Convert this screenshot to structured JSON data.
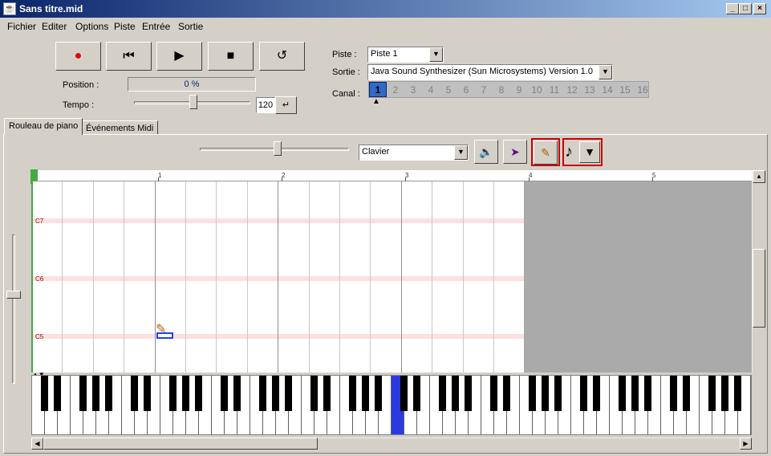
{
  "window": {
    "title": "Sans titre.mid",
    "app_icon": "java-cup-icon",
    "controls": {
      "minimize": "_",
      "maximize": "□",
      "close": "×"
    }
  },
  "menu": [
    "Fichier",
    "Editer",
    "Options",
    "Piste",
    "Entrée",
    "Sortie"
  ],
  "transport": {
    "record": "●",
    "rewind": "⏮",
    "play": "▶",
    "stop": "■",
    "loop": "↺"
  },
  "position": {
    "label": "Position :",
    "value": "0 %"
  },
  "tempo": {
    "label": "Tempo :",
    "value": "120",
    "apply": "↵",
    "slider_level": 0.55
  },
  "piste": {
    "label": "Piste :",
    "value": "Piste 1"
  },
  "sortie": {
    "label": "Sortie :",
    "value": "Java Sound Synthesizer (Sun Microsystems) Version 1.0"
  },
  "canal": {
    "label": "Canal :",
    "selected": "1",
    "channels": [
      "1",
      "2",
      "3",
      "4",
      "5",
      "6",
      "7",
      "8",
      "9",
      "10",
      "11",
      "12",
      "13",
      "14",
      "15",
      "16"
    ]
  },
  "tabs": [
    "Rouleau de piano",
    "Événements Midi"
  ],
  "editor": {
    "zoom_level": 0.55,
    "mode": "Clavier",
    "tools": {
      "speaker": "🔈",
      "select": "➤",
      "pencil": "✎",
      "note": "♪",
      "dropdown": "▼"
    }
  },
  "ruler_ticks": [
    "1",
    "2",
    "3",
    "4",
    "5"
  ],
  "note_labels": [
    "C7",
    "C6",
    "C5"
  ]
}
